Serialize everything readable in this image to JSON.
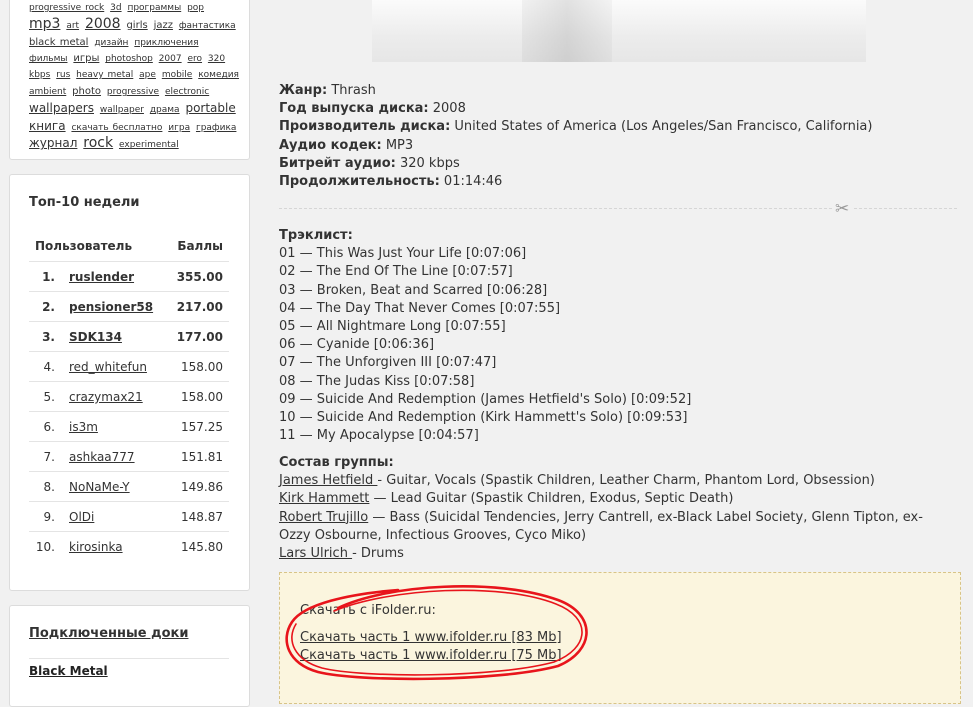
{
  "tag_cloud": [
    {
      "label": "progressive rock",
      "size": 1
    },
    {
      "label": "3d",
      "size": 1
    },
    {
      "label": "программы",
      "size": 1
    },
    {
      "label": "pop",
      "size": 1
    },
    {
      "label": "mp3",
      "size": 4
    },
    {
      "label": "art",
      "size": 1
    },
    {
      "label": "2008",
      "size": 4
    },
    {
      "label": "girls",
      "size": 2
    },
    {
      "label": "jazz",
      "size": 2
    },
    {
      "label": "фантастика",
      "size": 1
    },
    {
      "label": "black metal",
      "size": 2
    },
    {
      "label": "дизайн",
      "size": 1
    },
    {
      "label": "приключения",
      "size": 1
    },
    {
      "label": "фильмы",
      "size": 1
    },
    {
      "label": "игры",
      "size": 2
    },
    {
      "label": "photoshop",
      "size": 1
    },
    {
      "label": "2007",
      "size": 1
    },
    {
      "label": "ero",
      "size": 1
    },
    {
      "label": "320 kbps",
      "size": 1
    },
    {
      "label": "rus",
      "size": 1
    },
    {
      "label": "heavy metal",
      "size": 1
    },
    {
      "label": "ape",
      "size": 1
    },
    {
      "label": "mobile",
      "size": 1
    },
    {
      "label": "комедия",
      "size": 1
    },
    {
      "label": "ambient",
      "size": 1
    },
    {
      "label": "photo",
      "size": 2
    },
    {
      "label": "progressive",
      "size": 1
    },
    {
      "label": "electronic",
      "size": 1
    },
    {
      "label": "wallpapers",
      "size": 3
    },
    {
      "label": "wallpaper",
      "size": 1
    },
    {
      "label": "драма",
      "size": 1
    },
    {
      "label": "portable",
      "size": 3
    },
    {
      "label": "книга",
      "size": 3
    },
    {
      "label": "скачать бесплатно",
      "size": 1
    },
    {
      "label": "игра",
      "size": 1
    },
    {
      "label": "графика",
      "size": 1
    },
    {
      "label": "журнал",
      "size": 3
    },
    {
      "label": "rock",
      "size": 4
    },
    {
      "label": "experimental",
      "size": 1
    }
  ],
  "top10": {
    "title": "Топ-10 недели",
    "col_user": "Пользователь",
    "col_score": "Баллы",
    "rows": [
      {
        "rank": "1.",
        "user": "ruslender",
        "score": "355.00",
        "bold": true
      },
      {
        "rank": "2.",
        "user": "pensioner58",
        "score": "217.00",
        "bold": true
      },
      {
        "rank": "3.",
        "user": "SDK134",
        "score": "177.00",
        "bold": true
      },
      {
        "rank": "4.",
        "user": "red_whitefun",
        "score": "158.00",
        "bold": false
      },
      {
        "rank": "5.",
        "user": "crazymax21",
        "score": "158.00",
        "bold": false
      },
      {
        "rank": "6.",
        "user": "is3m",
        "score": "157.25",
        "bold": false
      },
      {
        "rank": "7.",
        "user": "ashkaa777",
        "score": "151.81",
        "bold": false
      },
      {
        "rank": "8.",
        "user": "NoNaMe-Y",
        "score": "149.86",
        "bold": false
      },
      {
        "rank": "9.",
        "user": "OlDi",
        "score": "148.87",
        "bold": false
      },
      {
        "rank": "10.",
        "user": "kirosinka",
        "score": "145.80",
        "bold": false
      }
    ]
  },
  "docs": {
    "title": "Подключенные доки",
    "item": "Black Metal"
  },
  "info": [
    {
      "label": "Жанр:",
      "value": "Thrash"
    },
    {
      "label": "Год выпуска диска:",
      "value": "2008"
    },
    {
      "label": "Производитель диска:",
      "value": "United States of America (Los Angeles/San Francisco, California)"
    },
    {
      "label": "Аудио кодек:",
      "value": "MP3"
    },
    {
      "label": "Битрейт аудио:",
      "value": "320 kbps"
    },
    {
      "label": "Продолжительность:",
      "value": "01:14:46"
    }
  ],
  "tracklist": {
    "title": "Трэклист:",
    "tracks": [
      "01 — This Was Just Your Life [0:07:06]",
      "02 — The End Of The Line [0:07:57]",
      "03 — Broken, Beat and Scarred [0:06:28]",
      "04 — The Day That Never Comes [0:07:55]",
      "05 — All Nightmare Long [0:07:55]",
      "06 — Cyanide [0:06:36]",
      "07 — The Unforgiven III [0:07:47]",
      "08 — The Judas Kiss [0:07:58]",
      "09 — Suicide And Redemption (James Hetfield's Solo) [0:09:52]",
      "10 — Suicide And Redemption (Kirk Hammett's Solo) [0:09:53]",
      "11 — My Apocalypse [0:04:57]"
    ]
  },
  "band": {
    "title": "Состав группы:",
    "members": [
      {
        "name": "James Hetfield ",
        "desc": "- Guitar, Vocals (Spastik Children, Leather Charm, Phantom Lord, Obsession)"
      },
      {
        "name": "Kirk Hammett",
        "desc": " — Lead Guitar (Spastik Children, Exodus, Septic Death)"
      },
      {
        "name": "Robert Trujillo",
        "desc": " — Bass (Suicidal Tendencies, Jerry Cantrell, ex-Black Label Society, Glenn Tipton, ex-Ozzy Osbourne, Infectious Grooves, Cyco Miko)"
      },
      {
        "name": "Lars Ulrich ",
        "desc": "- Drums"
      }
    ]
  },
  "download": {
    "title": "Скачать с iFolder.ru:",
    "link1": "Скачать часть  1 www.ifolder.ru [83 Mb]",
    "link2": "Скачать часть  1 www.ifolder.ru [75 Mb]"
  },
  "colors": {
    "page_bg": "#f1f1f1",
    "download_bg": "#fbf5de",
    "highlight_circle": "#e8141b"
  },
  "icons": {
    "separator": "scissors-icon"
  }
}
